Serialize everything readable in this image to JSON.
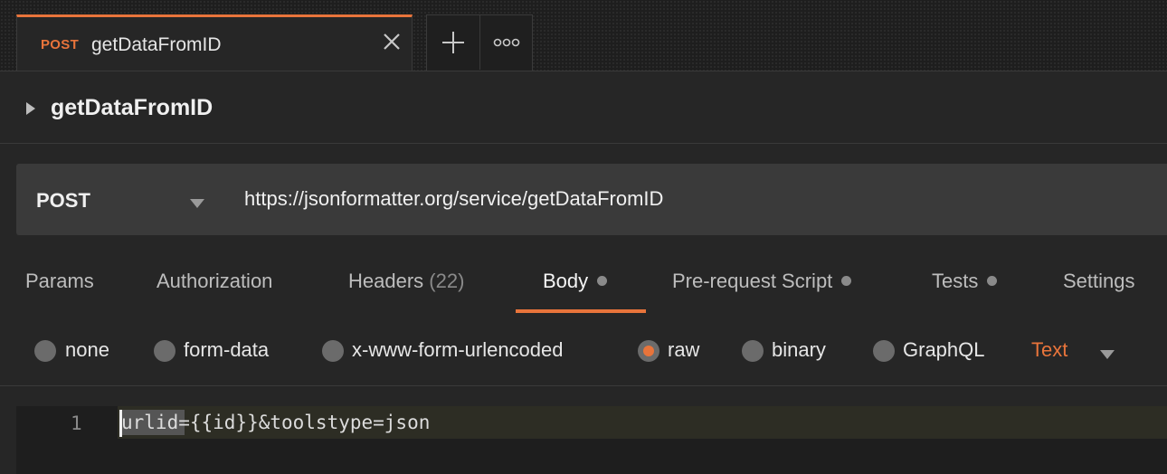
{
  "tab": {
    "method": "POST",
    "name": "getDataFromID"
  },
  "request": {
    "title": "getDataFromID",
    "method": "POST",
    "url": "https://jsonformatter.org/service/getDataFromID"
  },
  "request_tabs": [
    {
      "label": "Params"
    },
    {
      "label": "Authorization"
    },
    {
      "label": "Headers",
      "count": "(22)"
    },
    {
      "label": "Body",
      "active": true,
      "has_dot": true
    },
    {
      "label": "Pre-request Script",
      "has_dot": true
    },
    {
      "label": "Tests",
      "has_dot": true
    },
    {
      "label": "Settings"
    }
  ],
  "body_options": [
    {
      "label": "none",
      "selected": false
    },
    {
      "label": "form-data",
      "selected": false
    },
    {
      "label": "x-www-form-urlencoded",
      "selected": false
    },
    {
      "label": "raw",
      "selected": true
    },
    {
      "label": "binary",
      "selected": false
    },
    {
      "label": "GraphQL",
      "selected": false
    }
  ],
  "raw_format": "Text",
  "editor": {
    "line_number": "1",
    "code": "urlid={{id}}&toolstype=json"
  },
  "colors": {
    "accent": "#e8743b",
    "background": "#262626",
    "url_bar": "#3a3a3a"
  },
  "icons": {
    "close": "close-icon",
    "add": "plus-icon",
    "more": "more-icon",
    "expand": "caret-right-icon",
    "dropdown": "chevron-down-icon"
  }
}
